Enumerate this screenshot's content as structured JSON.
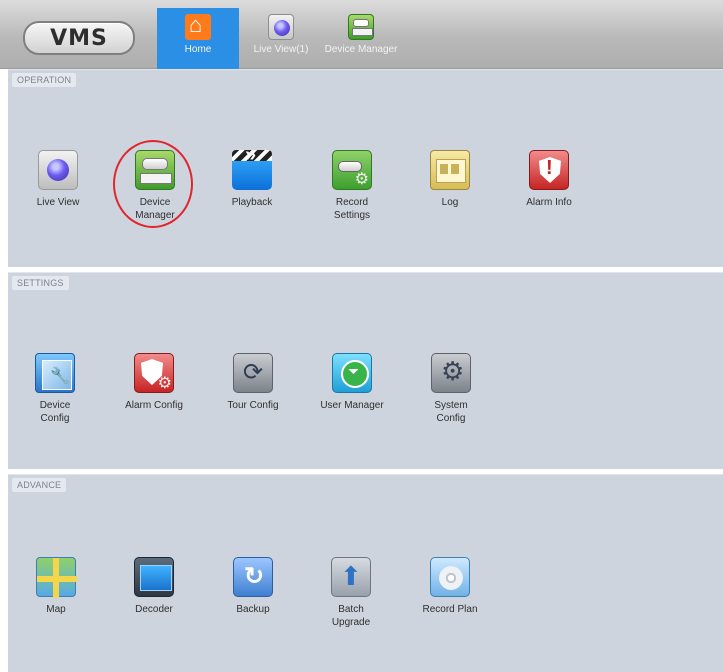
{
  "header": {
    "logo_text": "VMS",
    "tabs": [
      {
        "label": "Home",
        "icon": "home-icon",
        "active": true
      },
      {
        "label": "Live View(1)",
        "icon": "camera-icon",
        "active": false
      },
      {
        "label": "Device Manager",
        "icon": "device-icon",
        "active": false
      }
    ]
  },
  "sections": {
    "operation": {
      "title": "OPERATION",
      "items": [
        {
          "label": "Live View",
          "icon": "camera-lens-icon"
        },
        {
          "label": "Device Manager",
          "icon": "device-manager-icon"
        },
        {
          "label": "Playback",
          "icon": "clapperboard-icon"
        },
        {
          "label": "Record Settings",
          "icon": "record-settings-icon"
        },
        {
          "label": "Log",
          "icon": "log-icon"
        },
        {
          "label": "Alarm Info",
          "icon": "alarm-shield-icon"
        }
      ]
    },
    "settings": {
      "title": "SETTINGS",
      "items": [
        {
          "label": "Device Config",
          "icon": "device-config-icon"
        },
        {
          "label": "Alarm Config",
          "icon": "alarm-config-icon"
        },
        {
          "label": "Tour Config",
          "icon": "tour-icon"
        },
        {
          "label": "User Manager",
          "icon": "user-icon"
        },
        {
          "label": "System Config",
          "icon": "system-gear-icon"
        }
      ]
    },
    "advance": {
      "title": "ADVANCE",
      "items": [
        {
          "label": "Map",
          "icon": "map-icon"
        },
        {
          "label": "Decoder",
          "icon": "decoder-icon"
        },
        {
          "label": "Backup",
          "icon": "backup-icon"
        },
        {
          "label": "Batch Upgrade",
          "icon": "upload-arrow-icon"
        },
        {
          "label": "Record Plan",
          "icon": "disc-icon"
        }
      ]
    }
  },
  "colors": {
    "active_tab": "#2b8fe6",
    "panel_bg": "#ced4de",
    "annotation": "#e0262c"
  }
}
